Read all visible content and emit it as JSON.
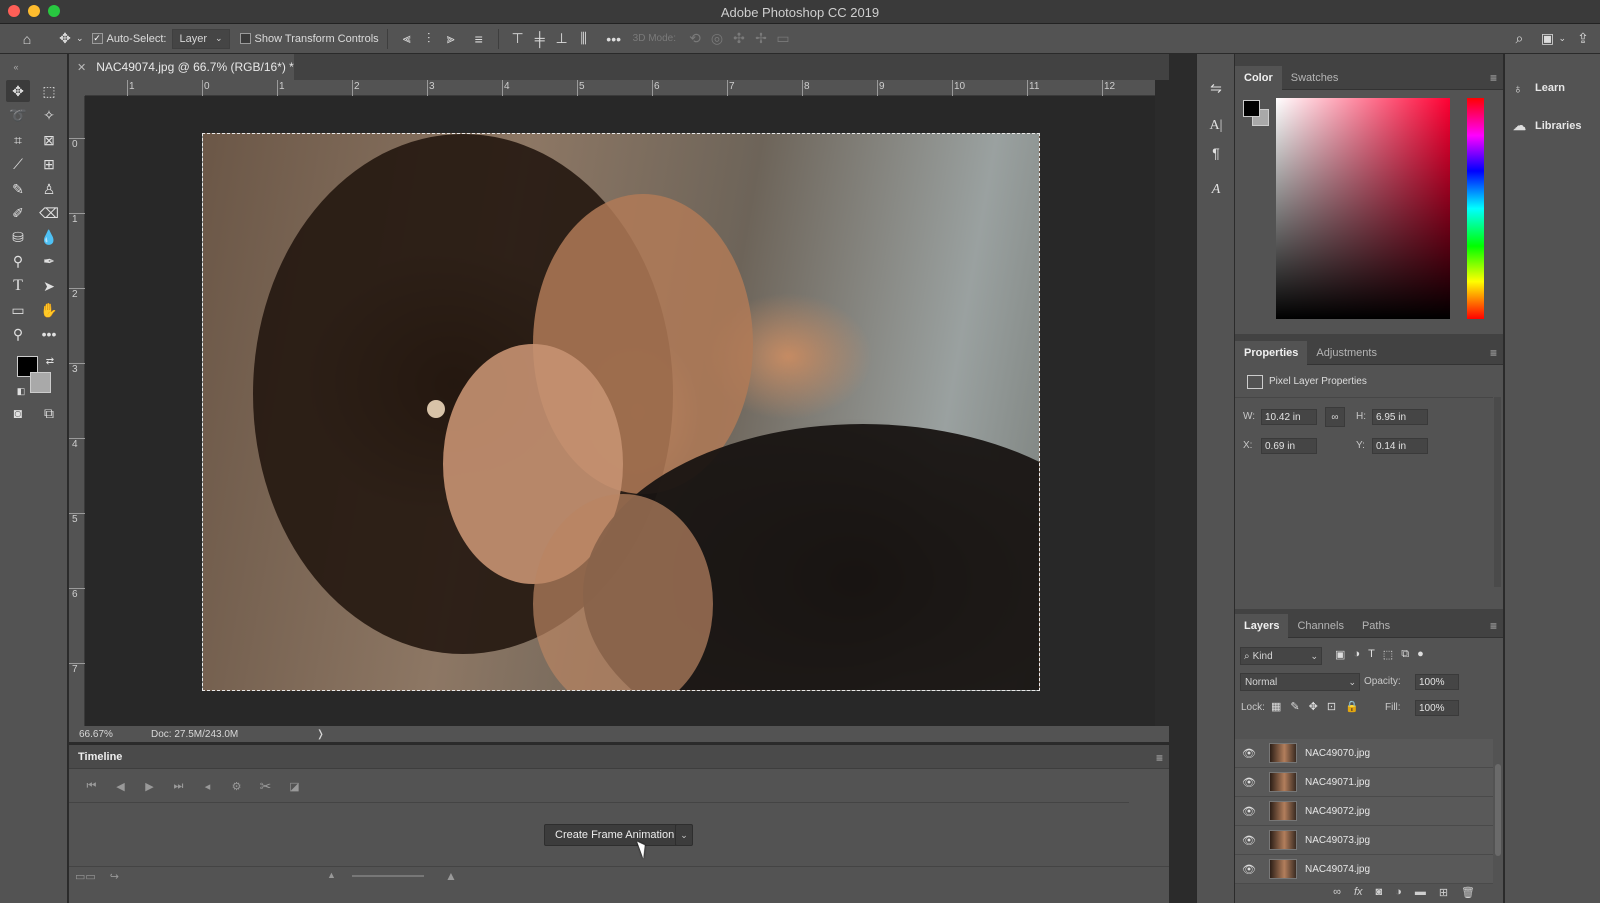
{
  "window": {
    "title": "Adobe Photoshop CC 2019"
  },
  "options_bar": {
    "auto_select_label": "Auto-Select:",
    "auto_select_value": "Layer",
    "transform_label": "Show Transform Controls",
    "mode_3d_label": "3D Mode:"
  },
  "document": {
    "tab_title": "NAC49074.jpg @ 66.7% (RGB/16*) *"
  },
  "rulers": {
    "h_labels": [
      "1",
      "0",
      "1",
      "2",
      "3",
      "4",
      "5",
      "6",
      "7",
      "8",
      "9",
      "10",
      "11",
      "12"
    ],
    "v_labels": [
      "0",
      "1",
      "2",
      "3",
      "4",
      "5",
      "6",
      "7"
    ]
  },
  "status_bar": {
    "zoom": "66.67%",
    "doc_size": "Doc: 27.5M/243.0M",
    "arrow": "❭"
  },
  "timeline": {
    "title": "Timeline",
    "create_button": "Create Frame Animation"
  },
  "color_panel": {
    "tabs": [
      "Color",
      "Swatches"
    ]
  },
  "properties_panel": {
    "tabs": [
      "Properties",
      "Adjustments"
    ],
    "heading": "Pixel Layer Properties",
    "w_label": "W:",
    "w_value": "10.42 in",
    "h_label": "H:",
    "h_value": "6.95 in",
    "x_label": "X:",
    "x_value": "0.69 in",
    "y_label": "Y:",
    "y_value": "0.14 in"
  },
  "layers_panel": {
    "tabs": [
      "Layers",
      "Channels",
      "Paths"
    ],
    "filter_label": "Kind",
    "blend_mode": "Normal",
    "opacity_label": "Opacity:",
    "opacity_value": "100%",
    "lock_label": "Lock:",
    "fill_label": "Fill:",
    "fill_value": "100%",
    "layers": [
      "NAC49070.jpg",
      "NAC49071.jpg",
      "NAC49072.jpg",
      "NAC49073.jpg",
      "NAC49074.jpg"
    ]
  },
  "learn_panel": {
    "learn_label": "Learn",
    "libraries_label": "Libraries"
  },
  "colors": {
    "ui_dark": "#282828",
    "ui_panel": "#535353",
    "foreground_swatch": "#000000",
    "background_swatch": "#a9a9a9"
  }
}
